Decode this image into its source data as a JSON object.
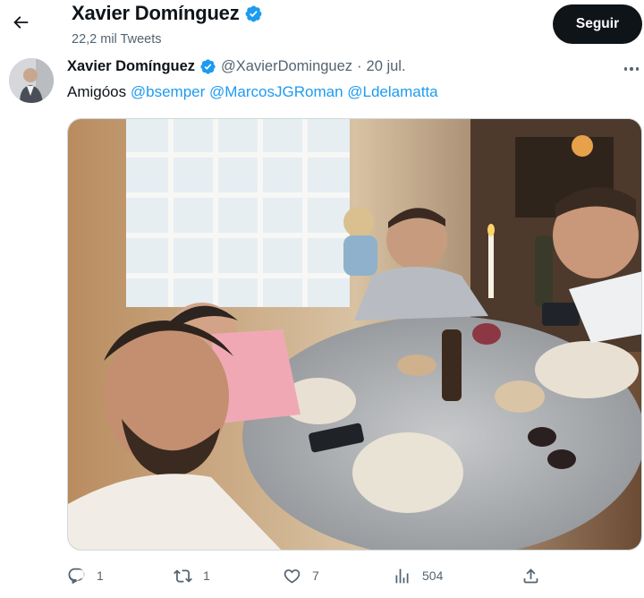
{
  "header": {
    "title": "Xavier Domínguez",
    "tweet_count": "22,2 mil Tweets",
    "follow_label": "Seguir"
  },
  "tweet": {
    "author_name": "Xavier Domínguez",
    "handle": "@XavierDominguez",
    "separator": "·",
    "date": "20 jul.",
    "text_prefix": "Amigóos ",
    "mentions": [
      "@bsemper",
      "@MarcosJGRoman",
      "@Ldelamatta"
    ]
  },
  "actions": {
    "replies": "1",
    "retweets": "1",
    "likes": "7",
    "views": "504"
  },
  "icons": [
    "back-arrow-icon",
    "verified-badge-icon",
    "more-icon",
    "reply-icon",
    "retweet-icon",
    "like-icon",
    "views-icon",
    "share-icon"
  ],
  "colors": {
    "accent": "#1d9bf0",
    "text": "#0f1419",
    "muted": "#536471",
    "button": "#0f1419"
  }
}
